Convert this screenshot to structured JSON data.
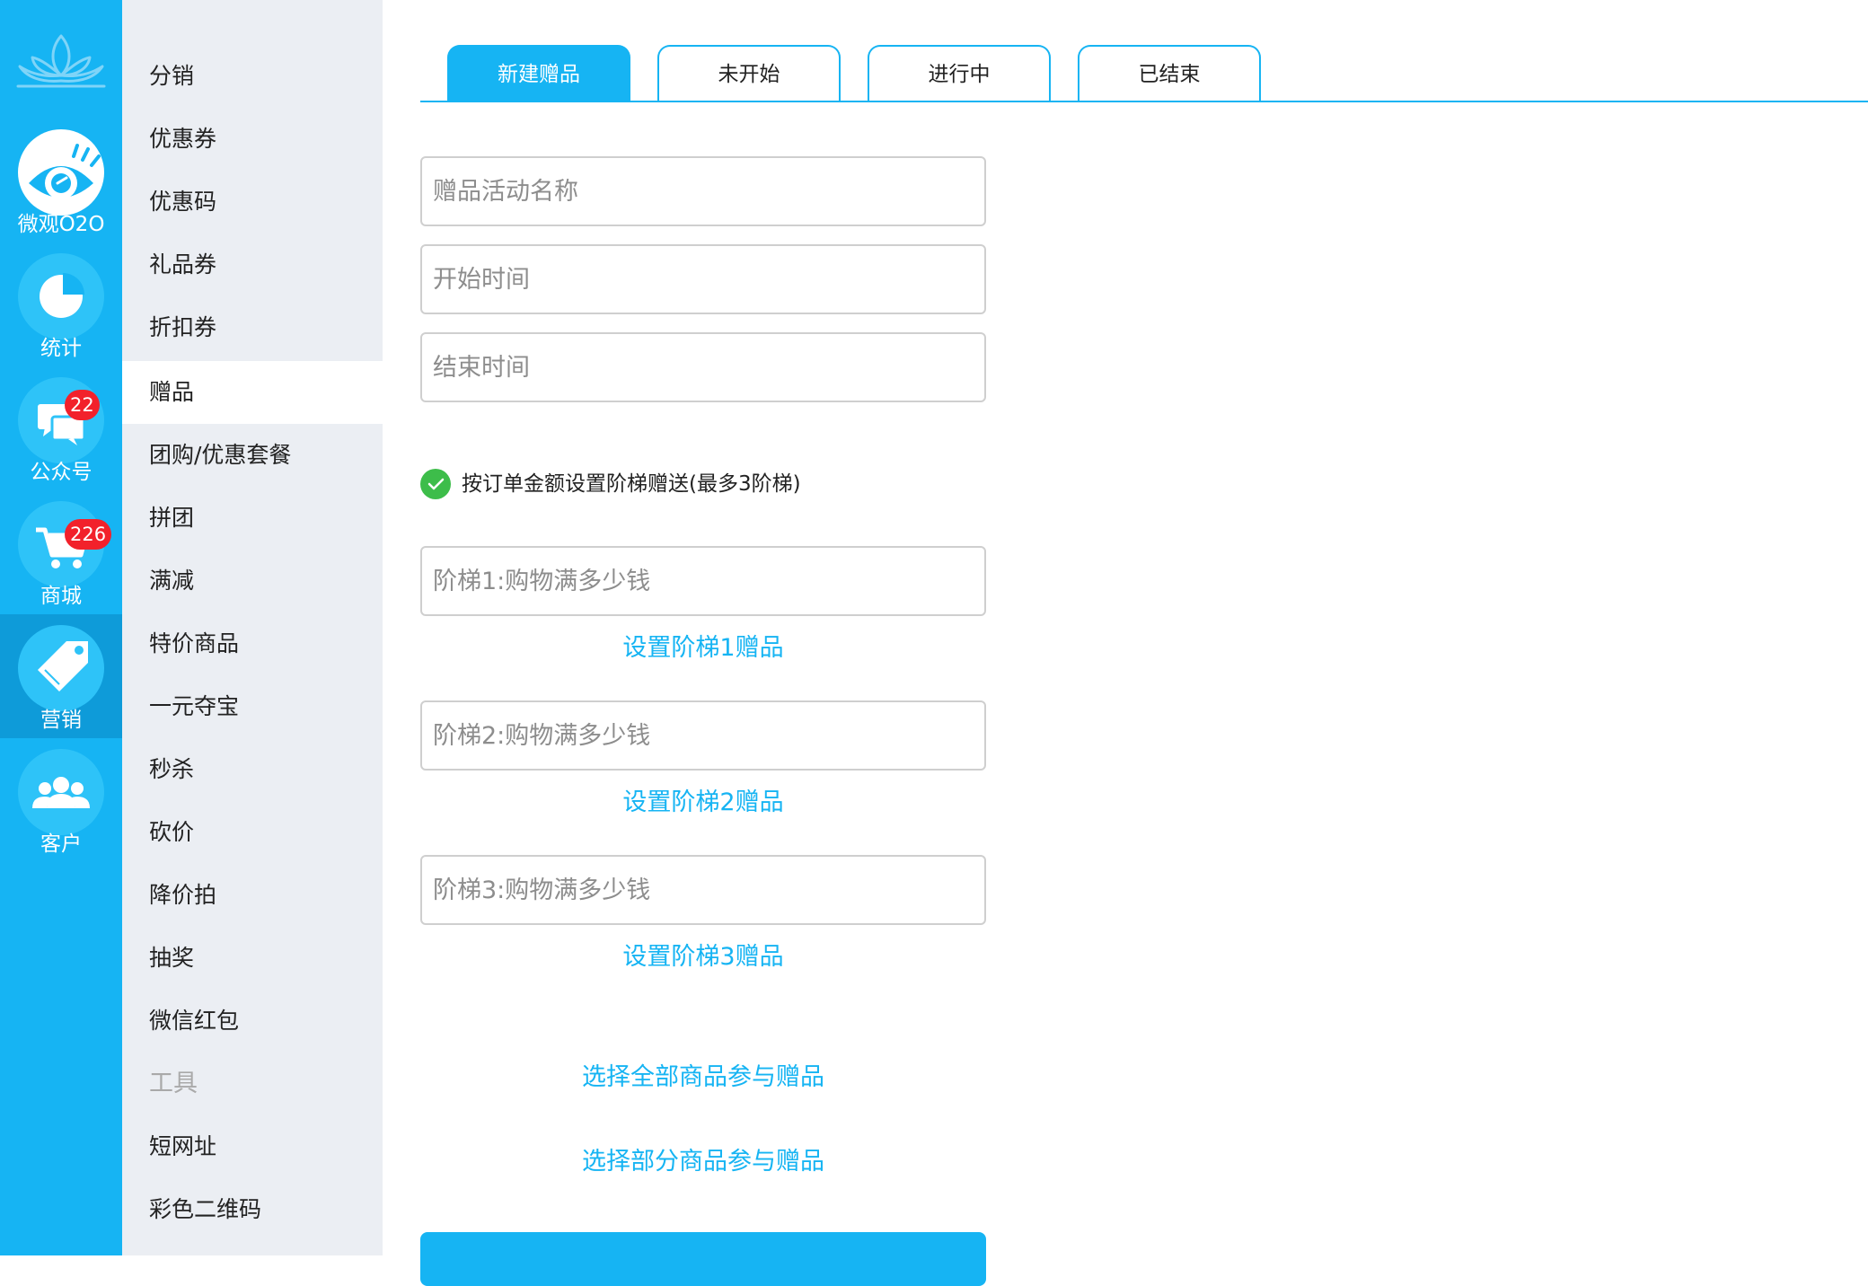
{
  "rail": {
    "items": [
      {
        "label": "微观O2O",
        "icon": "eye-icon"
      },
      {
        "label": "统计",
        "icon": "pie-chart-icon"
      },
      {
        "label": "公众号",
        "icon": "chat-bubbles-icon",
        "badge": "22"
      },
      {
        "label": "商城",
        "icon": "shopping-cart-icon",
        "badge": "226"
      },
      {
        "label": "营销",
        "icon": "price-tag-icon",
        "active": true
      },
      {
        "label": "客户",
        "icon": "users-icon"
      }
    ]
  },
  "menu": {
    "items": [
      "分销",
      "优惠券",
      "优惠码",
      "礼品券",
      "折扣券",
      "赠品",
      "团购/优惠套餐",
      "拼团",
      "满减",
      "特价商品",
      "一元夺宝",
      "秒杀",
      "砍价",
      "降价拍",
      "抽奖",
      "微信红包"
    ],
    "active": "赠品",
    "group_tools": "工具",
    "tool_items": [
      "短网址",
      "彩色二维码"
    ]
  },
  "tabs": [
    {
      "label": "新建赠品",
      "active": true
    },
    {
      "label": "未开始"
    },
    {
      "label": "进行中"
    },
    {
      "label": "已结束"
    }
  ],
  "form": {
    "name_placeholder": "赠品活动名称",
    "start_placeholder": "开始时间",
    "end_placeholder": "结束时间",
    "tier_checkbox_label": "按订单金额设置阶梯赠送(最多3阶梯)",
    "tier_checked": true,
    "tiers": [
      {
        "placeholder": "阶梯1:购物满多少钱",
        "link": "设置阶梯1赠品"
      },
      {
        "placeholder": "阶梯2:购物满多少钱",
        "link": "设置阶梯2赠品"
      },
      {
        "placeholder": "阶梯3:购物满多少钱",
        "link": "设置阶梯3赠品"
      }
    ],
    "select_all_link": "选择全部商品参与赠品",
    "select_part_link": "选择部分商品参与赠品"
  },
  "colors": {
    "accent": "#16b4f3",
    "rail_active": "#0e9bd9",
    "badge": "#f2212b",
    "check": "#3dbd4a",
    "menu_bg": "#ebeef3"
  }
}
